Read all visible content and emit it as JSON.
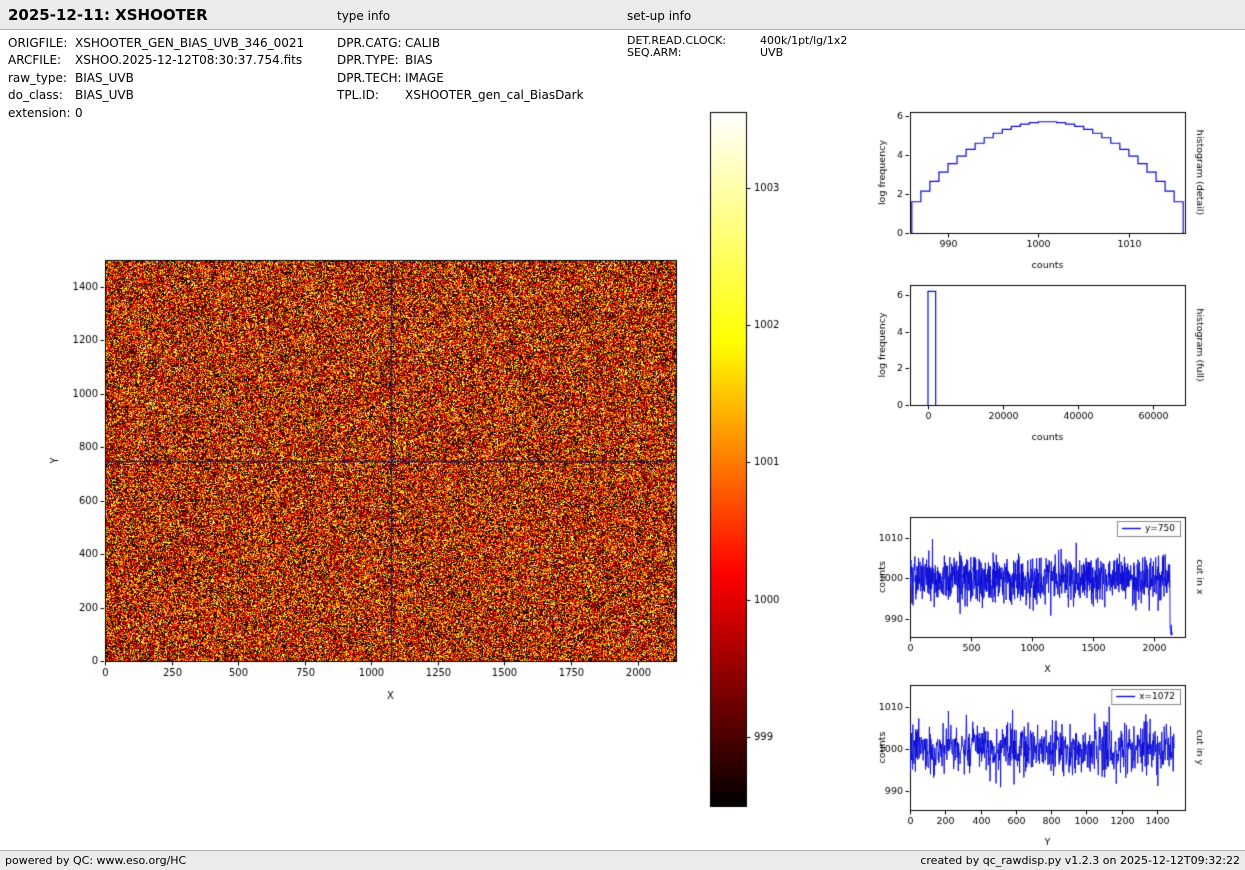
{
  "header": {
    "title": "2025-12-11: XSHOOTER",
    "type_info_label": "type info",
    "setup_info_label": "set-up info"
  },
  "file_info": {
    "rows": [
      {
        "label": "ORIGFILE:",
        "value": "XSHOOTER_GEN_BIAS_UVB_346_0021"
      },
      {
        "label": "ARCFILE:",
        "value": "XSHOO.2025-12-12T08:30:37.754.fits"
      },
      {
        "label": "raw_type:",
        "value": "BIAS_UVB"
      },
      {
        "label": "do_class:",
        "value": "BIAS_UVB"
      },
      {
        "label": "extension:",
        "value": "0"
      }
    ]
  },
  "type_info": {
    "rows": [
      {
        "label": "DPR.CATG:",
        "value": "CALIB"
      },
      {
        "label": "DPR.TYPE:",
        "value": "BIAS"
      },
      {
        "label": "DPR.TECH:",
        "value": "IMAGE"
      },
      {
        "label": "TPL.ID:",
        "value": "XSHOOTER_gen_cal_BiasDark"
      }
    ]
  },
  "setup_info": {
    "rows": [
      {
        "label": "DET.READ.CLOCK:",
        "value": "400k/1pt/lg/1x2"
      },
      {
        "label": "SEQ.ARM:",
        "value": "UVB"
      }
    ]
  },
  "footer": {
    "left": "powered by QC: www.eso.org/HC",
    "right": "created by qc_rawdisp.py v1.2.3 on 2025-12-12T09:32:22"
  },
  "colors": {
    "line_blue": "#0b0bd6",
    "crosshair": "#1c1c6e",
    "band_bg": "#ebebeb"
  },
  "chart_data": [
    {
      "id": "bias_image",
      "type": "heatmap",
      "xlabel": "X",
      "ylabel": "Y",
      "xlim": [
        0,
        2144
      ],
      "ylim": [
        0,
        1500
      ],
      "xticks": [
        0,
        250,
        500,
        750,
        1000,
        1250,
        1500,
        1750,
        2000
      ],
      "yticks": [
        0,
        200,
        400,
        600,
        800,
        1000,
        1200,
        1400
      ],
      "colormap": "hot",
      "clim": [
        998.5,
        1003.55
      ],
      "value_mean": 1000.0,
      "value_sigma": 1.5,
      "cut_x": 1072,
      "cut_y": 750,
      "seed": 20211
    },
    {
      "id": "colorbar",
      "type": "colorbar",
      "colormap": "hot",
      "range": [
        998.5,
        1003.55
      ],
      "ticks": [
        999,
        1000,
        1001,
        1002,
        1003
      ]
    },
    {
      "id": "histogram_detail",
      "type": "histogram",
      "side_label": "histogram (detail)",
      "xlabel": "counts",
      "ylabel": "log frequency",
      "xlim": [
        985.8,
        1016.2
      ],
      "ylim": [
        0,
        6.2
      ],
      "xticks": [
        990,
        1000,
        1010
      ],
      "yticks": [
        0,
        2,
        4,
        6
      ],
      "bin_start": 986,
      "bin_width": 1,
      "log_counts": [
        1.6,
        2.15,
        2.65,
        3.12,
        3.55,
        3.94,
        4.29,
        4.6,
        4.88,
        5.11,
        5.31,
        5.46,
        5.58,
        5.66,
        5.7,
        5.7,
        5.66,
        5.58,
        5.46,
        5.31,
        5.11,
        4.88,
        4.6,
        4.29,
        3.94,
        3.55,
        3.12,
        2.65,
        2.15,
        1.6
      ]
    },
    {
      "id": "histogram_full",
      "type": "histogram",
      "side_label": "histogram (full)",
      "xlabel": "counts",
      "ylabel": "log frequency",
      "xlim": [
        -4800,
        68600
      ],
      "ylim": [
        0,
        6.55
      ],
      "xticks": [
        0,
        20000,
        40000,
        60000
      ],
      "yticks": [
        0,
        2,
        4,
        6
      ],
      "bin_start": 0,
      "bin_width": 2048,
      "log_counts": [
        6.2
      ]
    },
    {
      "id": "cut_x",
      "type": "line",
      "side_label": "cut in x",
      "xlabel": "X",
      "ylabel": "counts",
      "legend": "y=750",
      "xlim": [
        0,
        2250
      ],
      "ylim": [
        985.5,
        1015.2
      ],
      "xticks": [
        0,
        500,
        1000,
        1500,
        2000
      ],
      "yticks": [
        990,
        1000,
        1010
      ],
      "series_mean": 1000,
      "series_sigma": 3.0,
      "n_points": 1072,
      "x_max": 2144,
      "seed": 101,
      "edge_dip": {
        "x_start": 2128,
        "value": 987
      }
    },
    {
      "id": "cut_y",
      "type": "line",
      "side_label": "cut in y",
      "xlabel": "Y",
      "ylabel": "counts",
      "legend": "x=1072",
      "xlim": [
        0,
        1560
      ],
      "ylim": [
        985.5,
        1015.2
      ],
      "xticks": [
        0,
        200,
        400,
        600,
        800,
        1000,
        1200,
        1400
      ],
      "yticks": [
        990,
        1000,
        1010
      ],
      "series_mean": 1000,
      "series_sigma": 3.0,
      "n_points": 750,
      "x_max": 1500,
      "seed": 202
    }
  ]
}
